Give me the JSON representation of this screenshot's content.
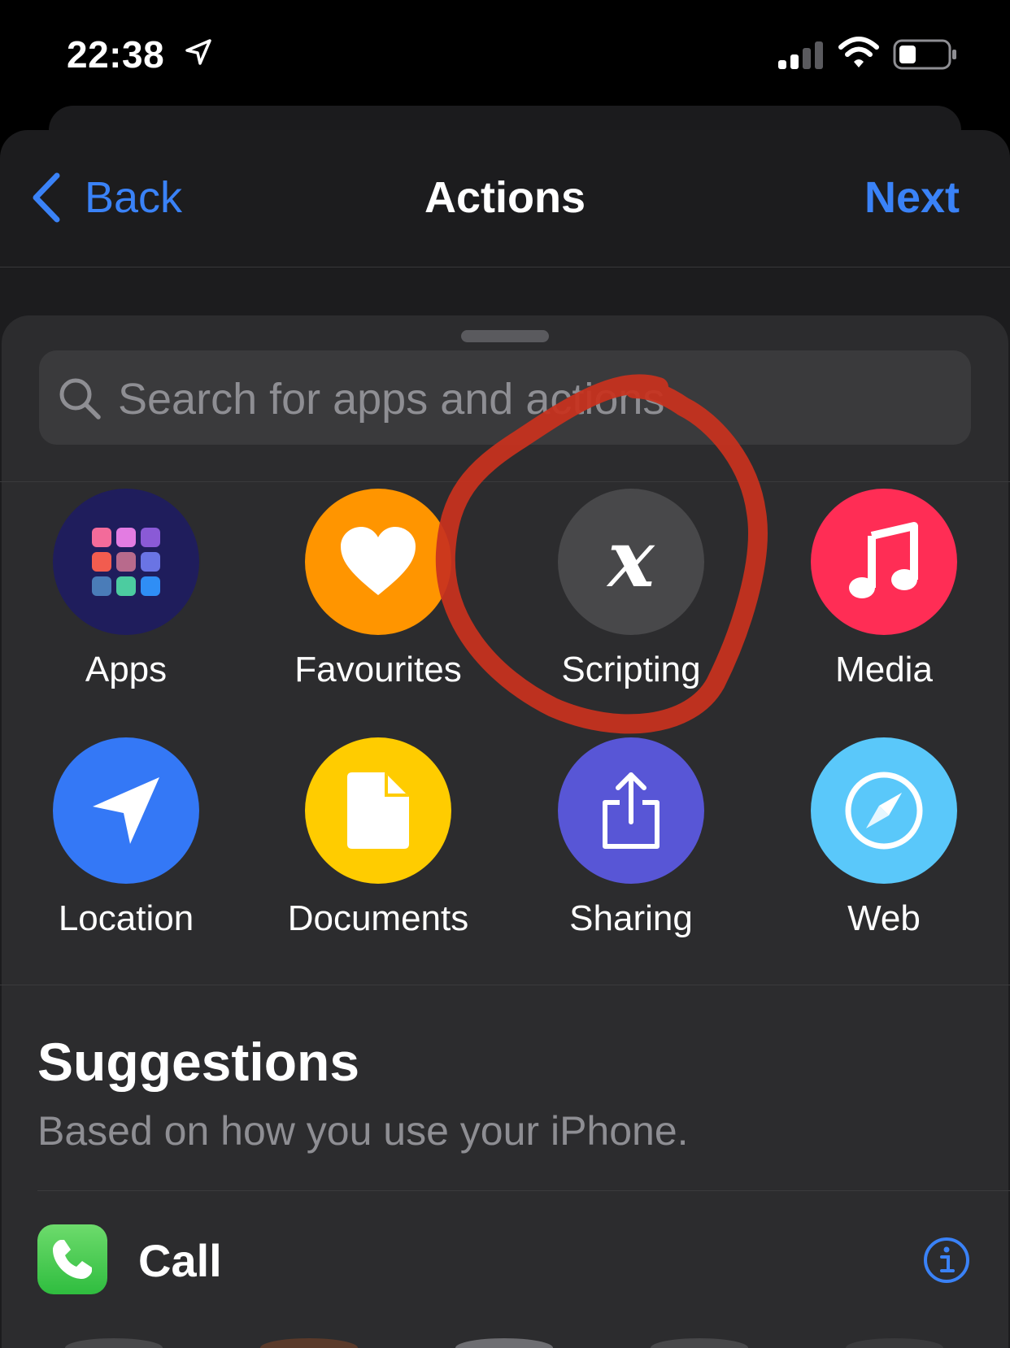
{
  "status_bar": {
    "time": "22:38",
    "location_icon": "location-arrow-icon",
    "signal_icon": "cellular-signal-icon",
    "wifi_icon": "wifi-icon",
    "battery_icon": "battery-icon"
  },
  "nav": {
    "back_label": "Back",
    "title": "Actions",
    "next_label": "Next",
    "accent_color": "#3a82f7"
  },
  "search": {
    "placeholder": "Search for apps and actions"
  },
  "categories": [
    {
      "label": "Apps",
      "icon": "apps-grid-icon",
      "color": "#1f1d5c"
    },
    {
      "label": "Favourites",
      "icon": "heart-icon",
      "color": "#ff9500"
    },
    {
      "label": "Scripting",
      "icon": "scripting-x-icon",
      "color": "#48484a"
    },
    {
      "label": "Media",
      "icon": "music-note-icon",
      "color": "#ff2d55"
    },
    {
      "label": "Location",
      "icon": "location-arrow-icon",
      "color": "#3478f6"
    },
    {
      "label": "Documents",
      "icon": "document-icon",
      "color": "#ffcc00"
    },
    {
      "label": "Sharing",
      "icon": "share-icon",
      "color": "#5856d6"
    },
    {
      "label": "Web",
      "icon": "compass-icon",
      "color": "#5ac8fa"
    }
  ],
  "scripting_symbol": "x",
  "annotation": {
    "color": "#c8321e",
    "icon": "red-hand-drawn-circle"
  },
  "suggestions": {
    "title": "Suggestions",
    "subtitle": "Based on how you use your iPhone.",
    "items": [
      {
        "label": "Call",
        "icon": "phone-icon",
        "info_icon": "info-icon"
      }
    ]
  }
}
